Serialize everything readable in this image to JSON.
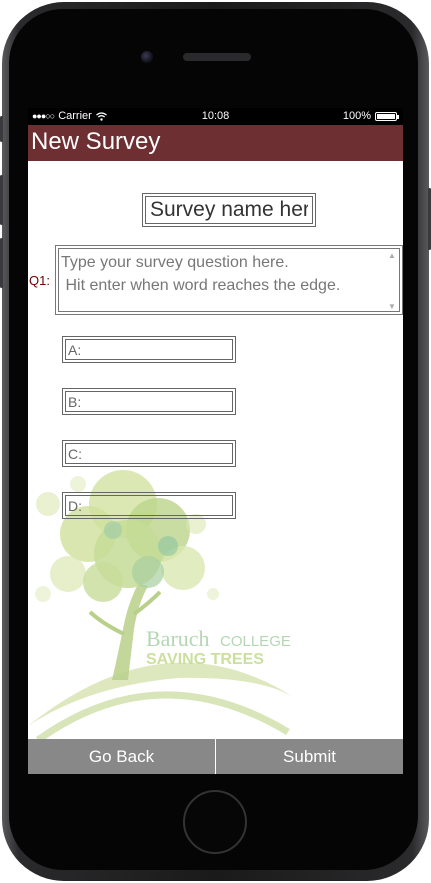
{
  "status_bar": {
    "carrier": "Carrier",
    "time": "10:08",
    "battery_label": "100%",
    "battery_level": 1.0
  },
  "header": {
    "title": "New Survey",
    "color": "#6d2f31"
  },
  "form": {
    "survey_name_placeholder": "Survey name here",
    "question_label": "Q1:",
    "question_placeholder": "Type your survey question here.\n Hit enter when word reaches the edge.",
    "answers": [
      {
        "placeholder": "A:"
      },
      {
        "placeholder": "B:"
      },
      {
        "placeholder": "C:"
      },
      {
        "placeholder": "D:"
      }
    ]
  },
  "background": {
    "logo_line1_main": "Baruch",
    "logo_line1_suffix": "COLLEGE",
    "logo_line2": "SAVING TREES"
  },
  "footer": {
    "back_label": "Go Back",
    "submit_label": "Submit",
    "button_color": "#888888"
  }
}
